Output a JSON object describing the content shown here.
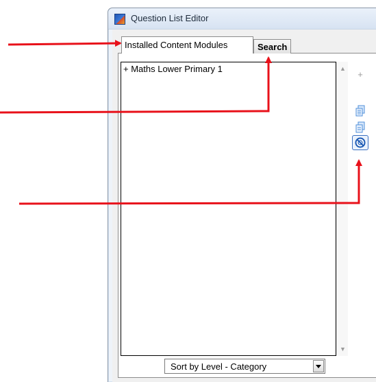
{
  "window": {
    "title": "Question List Editor",
    "app_icon": "app-logo-icon"
  },
  "tabs": [
    {
      "label": "Installed Content Modules",
      "active": true
    },
    {
      "label": "Search",
      "active": false
    }
  ],
  "list": {
    "items": [
      {
        "label": "+ Maths Lower Primary 1"
      }
    ]
  },
  "side_buttons": [
    {
      "icon": "plus-icon",
      "glyph": "+"
    },
    {
      "icon": "copy-documents-icon"
    },
    {
      "icon": "copy-document-icon"
    },
    {
      "icon": "block-icon"
    }
  ],
  "scrollbar": {
    "up_glyph": "▲",
    "down_glyph": "▼"
  },
  "sort": {
    "selected": "Sort by Level - Category"
  },
  "colors": {
    "annotation_arrow": "#e8111a",
    "accent": "#3b6fc1"
  }
}
